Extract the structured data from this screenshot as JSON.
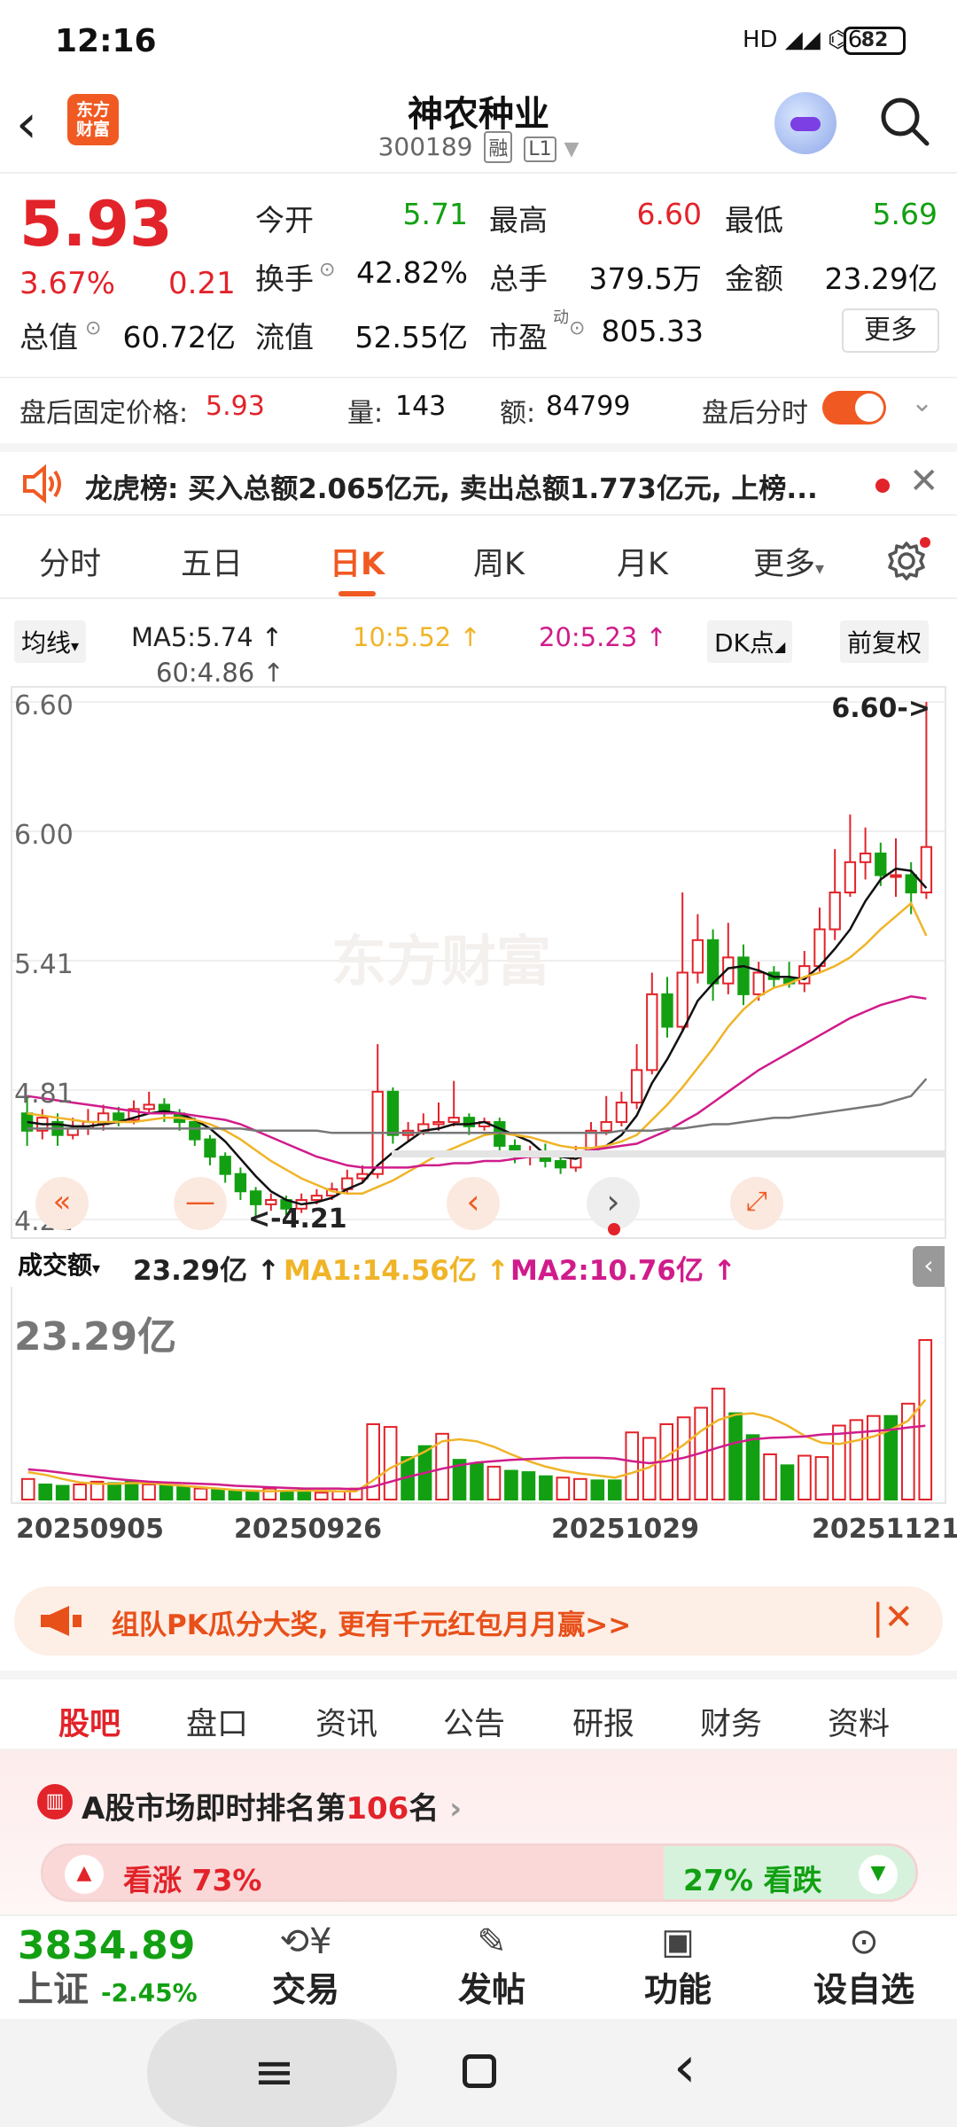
{
  "status_bar": {
    "time": "12:16",
    "signal": "HD ◢◢ ⌬6",
    "battery": "82"
  },
  "header": {
    "stock_name": "神农种业",
    "stock_code": "300189",
    "tag_rong": "融",
    "tag_level": "L1",
    "logo_text": "东方\n财富"
  },
  "quote": {
    "price": "5.93",
    "pct": "3.67%",
    "change": "0.21",
    "open_label": "今开",
    "open": "5.71",
    "high_label": "最高",
    "high": "6.60",
    "low_label": "最低",
    "low": "5.69",
    "turnover_label": "换手",
    "turnover": "42.82%",
    "volume_label": "总手",
    "volume": "379.5万",
    "amount_label": "金额",
    "amount": "23.29亿",
    "mktcap_label": "总值",
    "mktcap": "60.72亿",
    "float_label": "流值",
    "float_cap": "52.55亿",
    "pe_label": "市盈",
    "pe_sup": "动",
    "pe": "805.33",
    "more": "更多"
  },
  "after_hours": {
    "price_label": "盘后固定价格:",
    "price": "5.93",
    "vol_label": "量:",
    "vol": "143",
    "amt_label": "额:",
    "amt": "84799",
    "timeshare_label": "盘后分时"
  },
  "news": {
    "text": "龙虎榜: 买入总额2.065亿元, 卖出总额1.773亿元, 上榜..."
  },
  "k_tabs": [
    "分时",
    "五日",
    "日K",
    "周K",
    "月K",
    "更多"
  ],
  "indicators": {
    "ma_type": "均线",
    "ma5": "MA5:5.74 ↑",
    "ma10": "10:5.52 ↑",
    "ma20": "20:5.23 ↑",
    "ma60": "60:4.86 ↑",
    "dk": "DK点",
    "adjust": "前复权",
    "ma5_color": "#111111",
    "ma10_color": "#f0b428",
    "ma20_color": "#d01c8b",
    "ma60_color": "#777777"
  },
  "price_axis": {
    "labels": [
      "6.60",
      "6.00",
      "5.41",
      "4.81",
      "4.21"
    ],
    "high_marker": "6.60->",
    "low_marker": "<-4.21"
  },
  "volume_panel": {
    "label": "成交额",
    "value": "23.29亿 ↑",
    "ma1": "MA1:14.56亿 ↑",
    "ma2": "MA2:10.76亿 ↑",
    "big_value": "23.29亿"
  },
  "dates": [
    "20250905",
    "20250926",
    "20251029",
    "20251121"
  ],
  "chart_data": {
    "type": "candlestick",
    "ylim": [
      4.21,
      6.6
    ],
    "candles": [
      [
        4.7,
        4.62,
        4.78,
        4.55
      ],
      [
        4.62,
        4.68,
        4.72,
        4.58
      ],
      [
        4.66,
        4.6,
        4.7,
        4.55
      ],
      [
        4.6,
        4.63,
        4.68,
        4.58
      ],
      [
        4.63,
        4.66,
        4.72,
        4.6
      ],
      [
        4.65,
        4.7,
        4.74,
        4.62
      ],
      [
        4.7,
        4.67,
        4.73,
        4.64
      ],
      [
        4.67,
        4.72,
        4.76,
        4.65
      ],
      [
        4.72,
        4.74,
        4.8,
        4.7
      ],
      [
        4.74,
        4.7,
        4.77,
        4.66
      ],
      [
        4.7,
        4.66,
        4.72,
        4.62
      ],
      [
        4.66,
        4.58,
        4.68,
        4.55
      ],
      [
        4.58,
        4.5,
        4.6,
        4.46
      ],
      [
        4.5,
        4.42,
        4.52,
        4.38
      ],
      [
        4.42,
        4.34,
        4.45,
        4.3
      ],
      [
        4.34,
        4.28,
        4.36,
        4.21
      ],
      [
        4.28,
        4.3,
        4.33,
        4.25
      ],
      [
        4.3,
        4.26,
        4.32,
        4.23
      ],
      [
        4.26,
        4.3,
        4.33,
        4.24
      ],
      [
        4.3,
        4.32,
        4.35,
        4.28
      ],
      [
        4.32,
        4.35,
        4.38,
        4.3
      ],
      [
        4.35,
        4.4,
        4.44,
        4.33
      ],
      [
        4.4,
        4.42,
        4.46,
        4.38
      ],
      [
        4.42,
        4.8,
        5.02,
        4.4
      ],
      [
        4.8,
        4.6,
        4.82,
        4.56
      ],
      [
        4.6,
        4.62,
        4.66,
        4.57
      ],
      [
        4.62,
        4.65,
        4.7,
        4.6
      ],
      [
        4.65,
        4.66,
        4.75,
        4.62
      ],
      [
        4.66,
        4.68,
        4.85,
        4.64
      ],
      [
        4.68,
        4.64,
        4.7,
        4.6
      ],
      [
        4.64,
        4.66,
        4.68,
        4.62
      ],
      [
        4.66,
        4.55,
        4.68,
        4.52
      ],
      [
        4.55,
        4.5,
        4.58,
        4.47
      ],
      [
        4.5,
        4.52,
        4.55,
        4.46
      ],
      [
        4.52,
        4.48,
        4.56,
        4.45
      ],
      [
        4.48,
        4.45,
        4.5,
        4.42
      ],
      [
        4.45,
        4.52,
        4.55,
        4.43
      ],
      [
        4.52,
        4.62,
        4.66,
        4.5
      ],
      [
        4.62,
        4.66,
        4.78,
        4.6
      ],
      [
        4.66,
        4.75,
        4.8,
        4.64
      ],
      [
        4.75,
        4.9,
        5.02,
        4.72
      ],
      [
        4.9,
        5.25,
        5.35,
        4.88
      ],
      [
        5.25,
        5.1,
        5.33,
        5.05
      ],
      [
        5.1,
        5.35,
        5.72,
        5.08
      ],
      [
        5.35,
        5.5,
        5.62,
        5.3
      ],
      [
        5.5,
        5.3,
        5.55,
        5.22
      ],
      [
        5.3,
        5.42,
        5.58,
        5.25
      ],
      [
        5.42,
        5.25,
        5.48,
        5.2
      ],
      [
        5.25,
        5.35,
        5.4,
        5.22
      ],
      [
        5.35,
        5.32,
        5.38,
        5.28
      ],
      [
        5.32,
        5.3,
        5.4,
        5.28
      ],
      [
        5.3,
        5.38,
        5.45,
        5.26
      ],
      [
        5.38,
        5.55,
        5.65,
        5.35
      ],
      [
        5.55,
        5.72,
        5.92,
        5.5
      ],
      [
        5.72,
        5.86,
        6.08,
        5.7
      ],
      [
        5.86,
        5.9,
        6.02,
        5.78
      ],
      [
        5.9,
        5.8,
        5.95,
        5.75
      ],
      [
        5.8,
        5.8,
        5.97,
        5.7
      ],
      [
        5.8,
        5.72,
        5.86,
        5.62
      ],
      [
        5.72,
        5.93,
        6.6,
        5.69
      ]
    ],
    "series": [
      {
        "name": "MA5",
        "values": [
          4.66,
          4.65,
          4.65,
          4.64,
          4.64,
          4.65,
          4.66,
          4.68,
          4.7,
          4.71,
          4.7,
          4.67,
          4.63,
          4.57,
          4.49,
          4.41,
          4.34,
          4.3,
          4.28,
          4.29,
          4.31,
          4.35,
          4.38,
          4.46,
          4.52,
          4.57,
          4.62,
          4.63,
          4.65,
          4.65,
          4.66,
          4.63,
          4.6,
          4.57,
          4.51,
          4.5,
          4.49,
          4.52,
          4.55,
          4.6,
          4.69,
          4.84,
          4.95,
          5.08,
          5.22,
          5.3,
          5.37,
          5.38,
          5.36,
          5.33,
          5.33,
          5.32,
          5.38,
          5.46,
          5.55,
          5.68,
          5.78,
          5.83,
          5.82,
          5.74
        ]
      },
      {
        "name": "10",
        "values": [
          4.7,
          4.69,
          4.68,
          4.67,
          4.66,
          4.66,
          4.66,
          4.66,
          4.67,
          4.68,
          4.68,
          4.67,
          4.65,
          4.62,
          4.58,
          4.53,
          4.48,
          4.44,
          4.4,
          4.37,
          4.34,
          4.33,
          4.33,
          4.36,
          4.39,
          4.43,
          4.47,
          4.51,
          4.54,
          4.57,
          4.6,
          4.61,
          4.6,
          4.59,
          4.57,
          4.55,
          4.54,
          4.54,
          4.55,
          4.57,
          4.6,
          4.67,
          4.74,
          4.82,
          4.91,
          5.0,
          5.1,
          5.18,
          5.24,
          5.28,
          5.3,
          5.33,
          5.35,
          5.38,
          5.42,
          5.48,
          5.55,
          5.61,
          5.67,
          5.52
        ]
      },
      {
        "name": "20",
        "values": [
          4.78,
          4.77,
          4.76,
          4.75,
          4.74,
          4.73,
          4.72,
          4.71,
          4.7,
          4.7,
          4.7,
          4.69,
          4.68,
          4.67,
          4.65,
          4.62,
          4.59,
          4.56,
          4.53,
          4.5,
          4.48,
          4.46,
          4.45,
          4.45,
          4.45,
          4.45,
          4.46,
          4.46,
          4.47,
          4.47,
          4.48,
          4.48,
          4.49,
          4.5,
          4.5,
          4.51,
          4.52,
          4.53,
          4.54,
          4.55,
          4.56,
          4.59,
          4.62,
          4.66,
          4.7,
          4.75,
          4.8,
          4.85,
          4.9,
          4.94,
          4.98,
          5.02,
          5.06,
          5.1,
          5.14,
          5.17,
          5.2,
          5.22,
          5.24,
          5.23
        ]
      },
      {
        "name": "60",
        "values": [
          4.63,
          4.63,
          4.63,
          4.63,
          4.63,
          4.63,
          4.63,
          4.63,
          4.63,
          4.63,
          4.63,
          4.63,
          4.63,
          4.63,
          4.63,
          4.62,
          4.62,
          4.62,
          4.62,
          4.62,
          4.61,
          4.61,
          4.61,
          4.61,
          4.61,
          4.61,
          4.61,
          4.61,
          4.61,
          4.61,
          4.61,
          4.61,
          4.61,
          4.61,
          4.61,
          4.61,
          4.61,
          4.61,
          4.61,
          4.62,
          4.62,
          4.62,
          4.63,
          4.63,
          4.64,
          4.65,
          4.65,
          4.66,
          4.67,
          4.68,
          4.68,
          4.69,
          4.7,
          4.71,
          4.72,
          4.73,
          4.74,
          4.76,
          4.78,
          4.86
        ]
      }
    ],
    "volume": {
      "values": [
        3.0,
        2.2,
        2.0,
        2.2,
        2.6,
        2.4,
        2.6,
        2.2,
        2.0,
        1.8,
        1.6,
        1.4,
        1.2,
        1.2,
        1.6,
        1.2,
        1.4,
        1.0,
        1.2,
        1.6,
        11.0,
        10.6,
        6.2,
        7.8,
        9.6,
        5.8,
        5.2,
        4.8,
        4.2,
        4.0,
        3.4,
        3.2,
        3.0,
        2.8,
        2.8,
        9.8,
        9.0,
        11.0,
        12.0,
        13.4,
        16.2,
        12.6,
        9.4,
        6.6,
        5.0,
        6.4,
        6.2,
        10.8,
        11.6,
        12.2,
        12.2,
        14.0,
        23.29
      ],
      "up": [
        1,
        0,
        0,
        1,
        1,
        0,
        0,
        1,
        0,
        0,
        1,
        0,
        0,
        0,
        1,
        0,
        0,
        1,
        1,
        1,
        1,
        1,
        0,
        0,
        1,
        0,
        0,
        1,
        0,
        0,
        0,
        1,
        1,
        0,
        0,
        1,
        1,
        1,
        1,
        1,
        1,
        0,
        0,
        1,
        0,
        1,
        1,
        1,
        1,
        1,
        0,
        1,
        1
      ],
      "ma1": [
        4.0,
        3.6,
        3.0,
        2.5,
        2.3,
        2.3,
        2.4,
        2.4,
        2.2,
        2.0,
        1.8,
        1.6,
        1.4,
        1.3,
        1.2,
        1.3,
        1.3,
        1.3,
        1.2,
        1.2,
        2.8,
        4.6,
        5.8,
        7.0,
        8.5,
        8.8,
        8.5,
        7.7,
        6.6,
        5.6,
        4.8,
        4.2,
        3.8,
        3.5,
        3.2,
        3.9,
        4.7,
        6.3,
        8.0,
        10.0,
        11.6,
        12.4,
        12.6,
        12.0,
        10.8,
        9.3,
        8.3,
        8.1,
        8.6,
        9.2,
        10.2,
        11.5,
        14.56
      ],
      "ma2": [
        4.4,
        4.2,
        3.9,
        3.6,
        3.3,
        3.0,
        2.8,
        2.6,
        2.5,
        2.4,
        2.3,
        2.2,
        2.0,
        1.9,
        1.8,
        1.7,
        1.6,
        1.6,
        1.6,
        1.5,
        1.9,
        2.6,
        3.3,
        3.9,
        4.5,
        5.0,
        5.4,
        5.6,
        5.8,
        5.9,
        6.0,
        6.1,
        6.1,
        6.1,
        6.0,
        5.6,
        5.3,
        5.6,
        6.1,
        6.8,
        7.6,
        8.3,
        8.8,
        9.0,
        9.1,
        9.2,
        9.5,
        9.6,
        9.8,
        10.0,
        10.2,
        10.5,
        10.76
      ]
    }
  },
  "promo": {
    "text": "组队PK瓜分大奖, 更有千元红包月月赢>>"
  },
  "bottom_tabs": [
    "股吧",
    "盘口",
    "资讯",
    "公告",
    "研报",
    "财务",
    "资料"
  ],
  "ranking": {
    "prefix": "A股市场即时排名第",
    "rank": "106",
    "suffix": "名",
    "up_label": "看涨 73%",
    "down_label": "27% 看跌"
  },
  "index": {
    "value": "3834.89",
    "name": "上证",
    "change": "-2.45%"
  },
  "actions": [
    "交易",
    "发帖",
    "功能",
    "设自选"
  ]
}
